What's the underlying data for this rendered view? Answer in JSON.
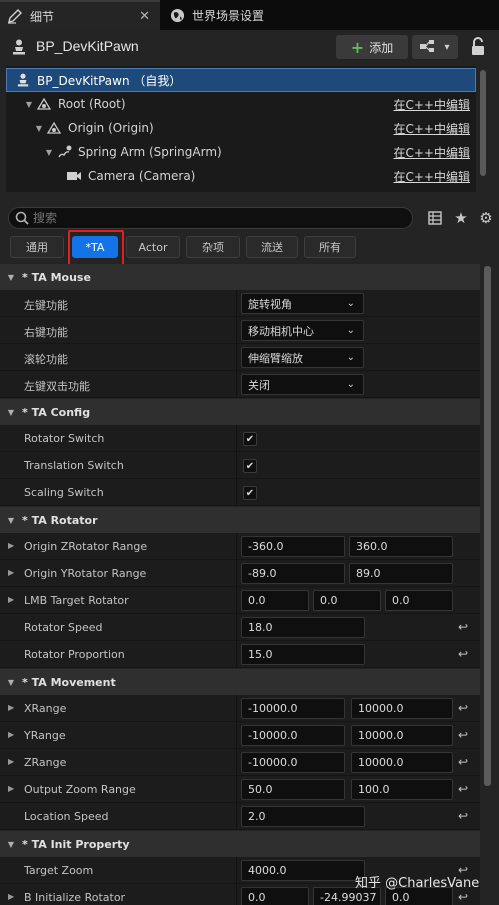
{
  "tabs": [
    {
      "label": "细节",
      "icon": "pencil-icon"
    },
    {
      "label": "世界场景设置",
      "icon": "globe-icon"
    }
  ],
  "header": {
    "title": "BP_DevKitPawn",
    "add_label": "添加"
  },
  "tree": [
    {
      "label": "BP_DevKitPawn （自我）",
      "icon": "pawn-icon",
      "edit": ""
    },
    {
      "label": "Root (Root)",
      "icon": "scene-component-icon",
      "edit": "在C++中编辑"
    },
    {
      "label": "Origin (Origin)",
      "icon": "scene-component-icon",
      "edit": "在C++中编辑"
    },
    {
      "label": "Spring Arm (SpringArm)",
      "icon": "spring-arm-icon",
      "edit": "在C++中编辑"
    },
    {
      "label": "Camera (Camera)",
      "icon": "camera-icon",
      "edit": "在C++中编辑"
    }
  ],
  "search": {
    "placeholder": "搜索"
  },
  "filters": [
    "通用",
    "*TA",
    "Actor",
    "杂项",
    "流送",
    "所有"
  ],
  "sections": {
    "mouse": "* TA Mouse",
    "config": "* TA Config",
    "rotator": "* TA Rotator",
    "movement": "* TA Movement",
    "init": "* TA Init Property"
  },
  "mouse": [
    {
      "label": "左键功能",
      "value": "旋转视角"
    },
    {
      "label": "右键功能",
      "value": "移动相机中心"
    },
    {
      "label": "滚轮功能",
      "value": "伸缩臂缩放"
    },
    {
      "label": "左键双击功能",
      "value": "关闭"
    }
  ],
  "config": [
    {
      "label": "Rotator Switch",
      "checked": true
    },
    {
      "label": "Translation Switch",
      "checked": true
    },
    {
      "label": "Scaling Switch",
      "checked": true
    }
  ],
  "rotator": [
    {
      "label": "Origin ZRotator Range",
      "values": [
        "-360.0",
        "360.0"
      ]
    },
    {
      "label": "Origin YRotator Range",
      "values": [
        "-89.0",
        "89.0"
      ]
    },
    {
      "label": "LMB Target Rotator",
      "values": [
        "0.0",
        "0.0",
        "0.0"
      ]
    },
    {
      "label": "Rotator Speed",
      "values": [
        "18.0"
      ]
    },
    {
      "label": "Rotator Proportion",
      "values": [
        "15.0"
      ]
    }
  ],
  "movement": [
    {
      "label": "XRange",
      "values": [
        "-10000.0",
        "10000.0"
      ]
    },
    {
      "label": "YRange",
      "values": [
        "-10000.0",
        "10000.0"
      ]
    },
    {
      "label": "ZRange",
      "values": [
        "-10000.0",
        "10000.0"
      ]
    },
    {
      "label": "Output Zoom Range",
      "values": [
        "50.0",
        "100.0"
      ]
    },
    {
      "label": "Location Speed",
      "values": [
        "2.0"
      ]
    }
  ],
  "init": [
    {
      "label": "Target Zoom",
      "values": [
        "4000.0"
      ]
    },
    {
      "label": "B Initialize Rotator",
      "values": [
        "0.0",
        "-24.99037",
        "0.0"
      ]
    }
  ],
  "watermark": "知乎 @CharlesVane"
}
